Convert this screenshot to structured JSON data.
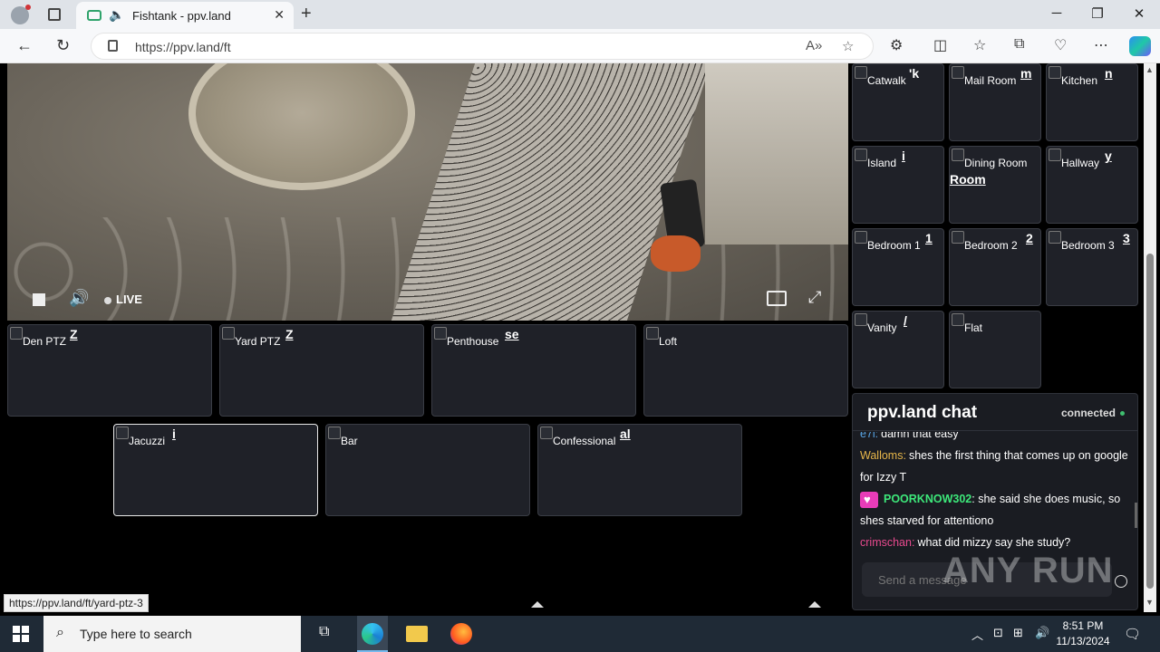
{
  "browser": {
    "tab_title": "Fishtank - ppv.land",
    "url": "https://ppv.land/ft",
    "status_url": "https://ppv.land/ft/yard-ptz-3"
  },
  "video": {
    "live_label": "LIVE"
  },
  "bottom_cams_row1": [
    {
      "name": "Den PTZ",
      "mark": "Z"
    },
    {
      "name": "Yard PTZ",
      "mark": "Z"
    },
    {
      "name": "Penthouse",
      "mark": "se"
    },
    {
      "name": "Loft",
      "mark": ""
    }
  ],
  "bottom_cams_row2": [
    {
      "name": "Jacuzzi",
      "mark": "i"
    },
    {
      "name": "Bar",
      "mark": ""
    },
    {
      "name": "Confessional",
      "mark": "al"
    }
  ],
  "side_cams": [
    {
      "name": "Catwalk",
      "mark": "'k"
    },
    {
      "name": "Mail Room",
      "mark": "m"
    },
    {
      "name": "Kitchen",
      "mark": "n"
    },
    {
      "name": "Island",
      "mark": "i"
    },
    {
      "name": "Dining Room",
      "mark": "Room"
    },
    {
      "name": "Hallway",
      "mark": "y"
    },
    {
      "name": "Bedroom 1",
      "mark": "1"
    },
    {
      "name": "Bedroom 2",
      "mark": "2"
    },
    {
      "name": "Bedroom 3",
      "mark": "3"
    },
    {
      "name": "Vanity",
      "mark": "/"
    },
    {
      "name": "Flat",
      "mark": ""
    }
  ],
  "chat": {
    "title": "ppv.land chat",
    "status": "connected",
    "messages": [
      {
        "user": "e7l:",
        "text": "damn that easy",
        "color": "#5aa7e8"
      },
      {
        "user": "Walloms:",
        "text": "shes the first thing that comes up on google for Izzy T",
        "color": "#e8b74a"
      },
      {
        "user": "POORKNOW302",
        "text": ": she said she does music, so shes starved for attentiono",
        "color": "#3de87a"
      },
      {
        "user": "crimschan:",
        "text": "what did mizzy say she study?",
        "color": "#e84a8f"
      }
    ],
    "input_placeholder": "Send a message"
  },
  "watermark": "ANY RUN",
  "taskbar": {
    "search_placeholder": "Type here to search",
    "time": "8:51 PM",
    "date": "11/13/2024"
  }
}
